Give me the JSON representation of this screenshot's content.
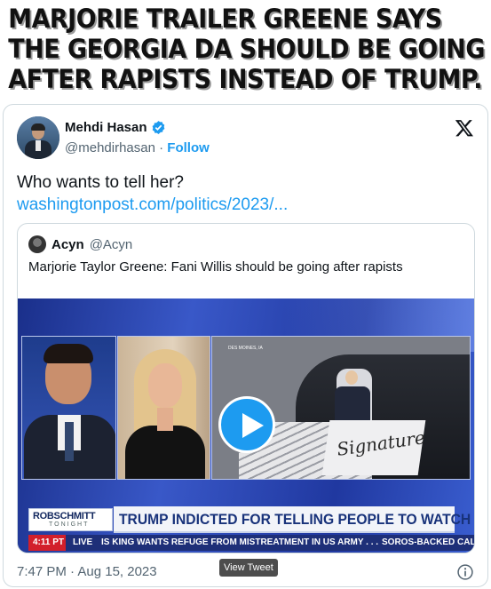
{
  "caption": {
    "line1": "MARJORIE TRAILER GREENE SAYS",
    "line2": "THE GEORGIA DA SHOULD BE GOING",
    "line3": "AFTER RAPISTS INSTEAD OF TRUMP."
  },
  "tweet": {
    "display_name": "Mehdi Hasan",
    "handle": "@mehdirhasan",
    "separator": " · ",
    "follow_label": "Follow",
    "text": "Who wants to tell her?",
    "link": "washingtonpost.com/politics/2023/...",
    "timestamp": "7:47 PM · Aug 15, 2023",
    "icons": {
      "verified": "verified-badge-icon",
      "brand": "x-logo-icon",
      "info": "info-icon"
    },
    "colors": {
      "accent": "#1d9bf0",
      "muted": "#536471",
      "text": "#0f1419"
    }
  },
  "quote": {
    "display_name": "Acyn",
    "handle": "@Acyn",
    "text": "Marjorie Taylor Greene: Fani Willis should be going after rapists"
  },
  "video": {
    "show_logo": "ROBSCHMITT",
    "show_logo_sub": "TONIGHT",
    "headline": "TRUMP INDICTED FOR TELLING PEOPLE TO WATCH NEWSMAX",
    "time": "4:11 PT",
    "live_label": "LIVE",
    "ticker": "IS KING WANTS REFUGE FROM MISTREATMENT IN US ARMY . . .",
    "ticker2": "SOROS-BACKED CAL",
    "sign_text": "Signature",
    "location_tag": "DES MOINES, IA"
  },
  "tooltip": "View Tweet"
}
